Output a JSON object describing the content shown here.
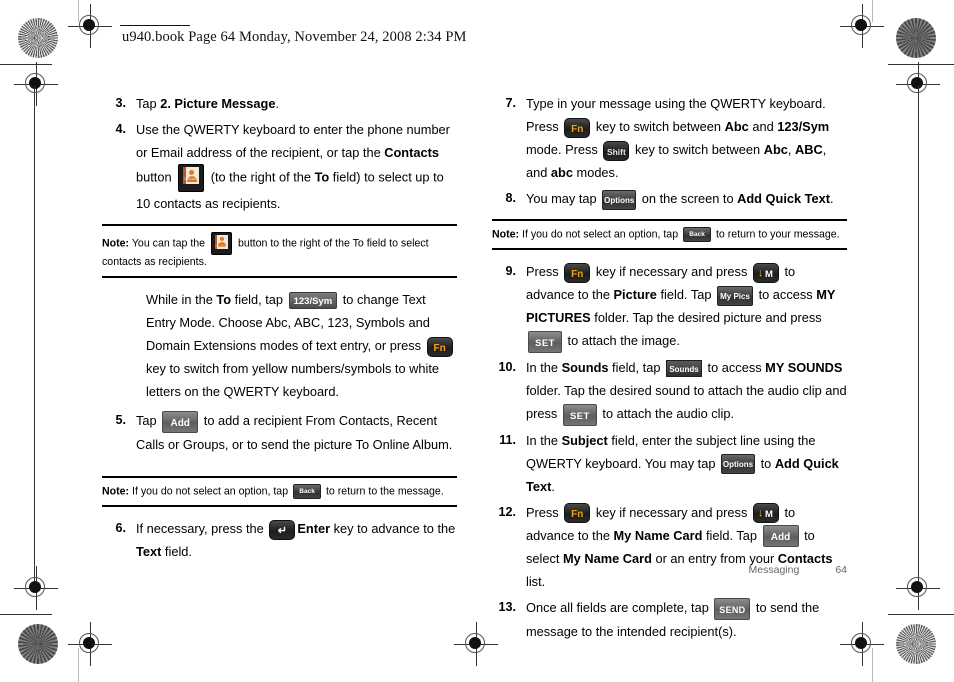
{
  "document": {
    "header_line": "u940.book  Page 64  Monday, November 24, 2008  2:34 PM",
    "footer_chapter": "Messaging",
    "footer_page": "64"
  },
  "keys": {
    "contacts": "Contacts",
    "fn": "Fn",
    "shift": "Shift",
    "enter": "↵",
    "m": "M",
    "m_arrow": "↓",
    "sym": "123/Sym",
    "add": "Add",
    "set": "SET",
    "send": "SEND",
    "options": "Options",
    "mypics": "My Pics",
    "sounds": "Sounds",
    "back": "Back"
  },
  "left_column": {
    "step3": {
      "num": "3.",
      "t1": "Tap ",
      "b1": "2. Picture Message",
      "t2": "."
    },
    "step4": {
      "num": "4.",
      "t1": "Use the QWERTY keyboard to enter the phone number or Email address of the recipient, or tap the ",
      "b1": "Contacts",
      "t2": " button ",
      "t3": " (to the right of the ",
      "b2": "To",
      "t4": " field) to select up to 10 contacts as recipients."
    },
    "note1": {
      "label": "Note:",
      "t1": " You can tap the ",
      "t2": " button to the right of the To field to select contacts as recipients."
    },
    "para1": {
      "t1": "While in the ",
      "b1": "To",
      "t2": " field, tap ",
      "t3": " to change Text Entry Mode. Choose Abc, ABC, 123, Symbols and Domain Extensions modes of text entry, or press ",
      "t4": " key to switch from yellow numbers/symbols to white letters on the QWERTY keyboard."
    },
    "step5": {
      "num": "5.",
      "t1": "Tap ",
      "t2": " to add a recipient From Contacts, Recent Calls or Groups, or to send the picture To Online Album."
    },
    "note2": {
      "label": "Note:",
      "t1": " If you do not select an option, tap ",
      "t2": " to return to the message."
    },
    "step6": {
      "num": "6.",
      "t1": "If necessary, press the ",
      "b1": "Enter",
      "t2": " key to advance to the ",
      "b2": "Text",
      "t3": " field."
    }
  },
  "right_column": {
    "step7": {
      "num": "7.",
      "t1": "Type in your message using the QWERTY keyboard. Press ",
      "t2": " key to switch between ",
      "b1": "Abc",
      "t3": " and ",
      "b2": "123/Sym",
      "t4": " mode. Press ",
      "t5": " key to switch between ",
      "b3": "Abc",
      "t6": ", ",
      "b4": "ABC",
      "t7": ", and ",
      "b5": "abc",
      "t8": " modes."
    },
    "step8": {
      "num": "8.",
      "t1": "You may tap ",
      "t2": " on the screen to ",
      "b1": "Add Quick Text",
      "t3": "."
    },
    "note3": {
      "label": "Note:",
      "t1": " If you do not select an option, tap ",
      "t2": " to return to your message."
    },
    "step9": {
      "num": "9.",
      "t1": "Press ",
      "t2": " key if necessary and press ",
      "t3": " to advance to the ",
      "b1": "Picture",
      "t4": " field. Tap ",
      "t5": " to access ",
      "b2": "MY PICTURES",
      "t6": " folder. Tap the desired picture and press ",
      "t7": " to attach the image."
    },
    "step10": {
      "num": "10.",
      "t1": "In the ",
      "b1": "Sounds",
      "t2": " field, tap ",
      "t3": " to access ",
      "b2": "MY SOUNDS",
      "t4": " folder. Tap the desired sound to attach the audio clip and press ",
      "t5": " to attach the audio clip."
    },
    "step11": {
      "num": "11.",
      "t1": "In the ",
      "b1": "Subject",
      "t2": " field, enter the subject line using the QWERTY keyboard. You may tap ",
      "t3": " to ",
      "b2": "Add Quick Text",
      "t4": "."
    },
    "step12": {
      "num": "12.",
      "t1": "Press ",
      "t2": " key if necessary and press ",
      "t3": " to advance to the ",
      "b1": "My Name Card",
      "t4": " field. Tap ",
      "t5": " to select ",
      "b2": "My Name Card",
      "t6": " or an entry from your ",
      "b3": "Contacts",
      "t7": " list."
    },
    "step13": {
      "num": "13.",
      "t1": "Once all fields are complete, tap ",
      "t2": " to send the message to the intended recipient(s)."
    }
  }
}
